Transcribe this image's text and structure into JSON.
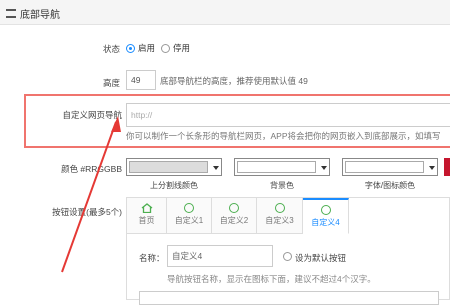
{
  "section": {
    "title": "底部导航"
  },
  "status": {
    "label": "状态",
    "options": [
      "启用",
      "停用"
    ],
    "selected": 0
  },
  "height": {
    "label": "高度",
    "value": "49",
    "hint": "底部导航栏的高度，推荐使用默认值 49"
  },
  "custom_page": {
    "label": "自定义网页导航",
    "placeholder": "http://",
    "hint": "你可以制作一个长条形的导航栏网页，APP将会把你的网页嵌入到底部展示，如填写"
  },
  "colors": {
    "label": "颜色 #RRGGBB",
    "items": [
      {
        "caption": "上分割线颜色",
        "color": "#dcdcdc"
      },
      {
        "caption": "背景色",
        "color": "#ffffff"
      },
      {
        "caption": "字体/图标颜色",
        "color": "#ffffff"
      },
      {
        "caption": "",
        "color": "#c5162e"
      }
    ]
  },
  "buttons": {
    "label": "按钮设置(最多5个)",
    "tabs": [
      {
        "label": "首页",
        "icon": "home-icon"
      },
      {
        "label": "自定义1",
        "icon": "circle-icon"
      },
      {
        "label": "自定义2",
        "icon": "circle-icon"
      },
      {
        "label": "自定义3",
        "icon": "circle-icon"
      },
      {
        "label": "自定义4",
        "icon": "circle-icon"
      }
    ],
    "active_tab": 4,
    "name_label": "名称：",
    "name_value": "自定义4",
    "default_button_label": "设为默认按钮",
    "name_hint": "导航按钮名称，显示在图标下面，建议不超过4个汉字。"
  },
  "accent": "#1a8cff",
  "annotation_color": "#e53935"
}
